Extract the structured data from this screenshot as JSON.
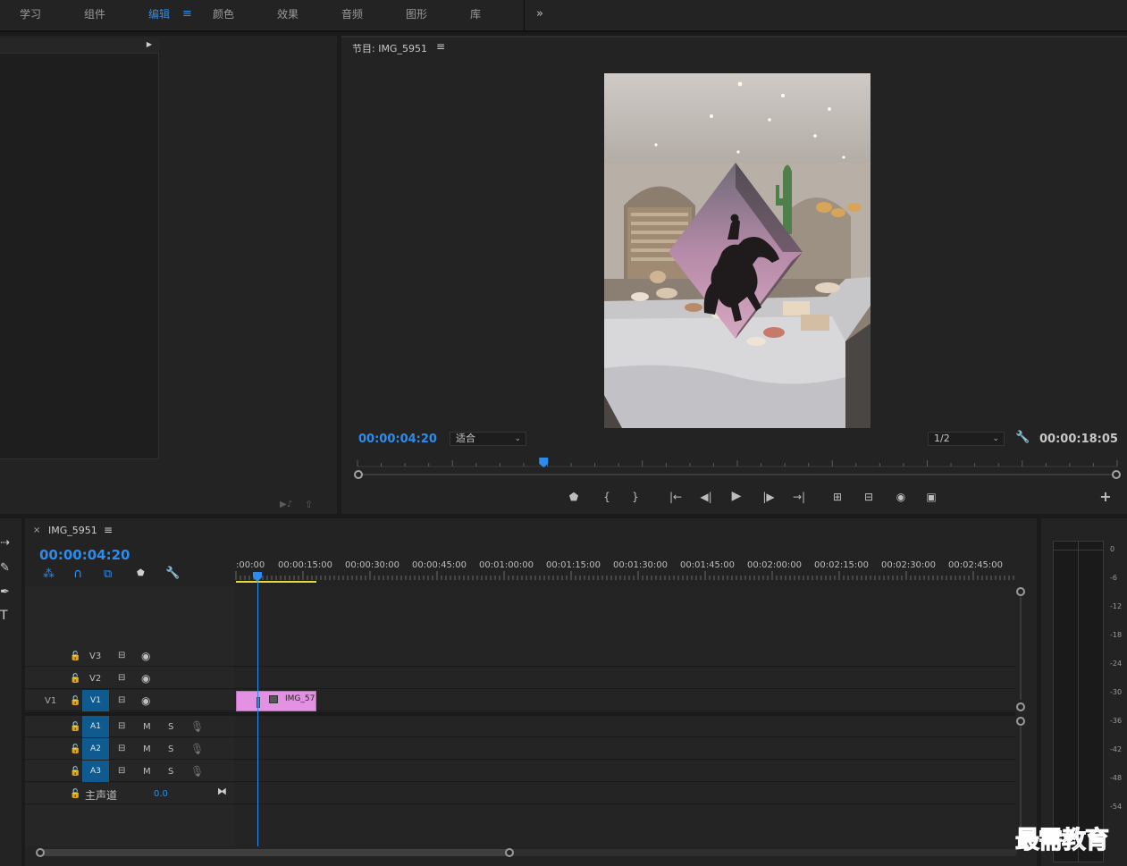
{
  "workspaces": [
    {
      "label": "学习",
      "active": false
    },
    {
      "label": "组件",
      "active": false
    },
    {
      "label": "编辑",
      "active": true
    },
    {
      "label": "颜色",
      "active": false
    },
    {
      "label": "效果",
      "active": false
    },
    {
      "label": "音频",
      "active": false
    },
    {
      "label": "图形",
      "active": false
    },
    {
      "label": "库",
      "active": false
    }
  ],
  "workspace_menu_icon": "hamburger-icon",
  "workspace_more_icon": "double-chevron-right-icon",
  "program": {
    "title": "节目: IMG_5951",
    "menu_icon": "hamburger-icon",
    "current_time": "00:00:04:20",
    "zoom": "适合",
    "resolution": "1/2",
    "duration": "00:00:18:05",
    "playhead_fraction": 0.245
  },
  "timeline": {
    "sequence_name": "IMG_5951",
    "current_time": "00:00:04:20",
    "ruler_labels": [
      ":00:00",
      "00:00:15:00",
      "00:00:30:00",
      "00:00:45:00",
      "00:01:00:00",
      "00:01:15:00",
      "00:01:30:00",
      "00:01:45:00",
      "00:02:00:00",
      "00:02:15:00",
      "00:02:30:00",
      "00:02:45:00"
    ],
    "video_tracks": [
      {
        "name": "V3",
        "source": ""
      },
      {
        "name": "V2",
        "source": ""
      },
      {
        "name": "V1",
        "source": "V1"
      }
    ],
    "audio_tracks": [
      {
        "name": "A1",
        "m": "M",
        "s": "S"
      },
      {
        "name": "A2",
        "m": "M",
        "s": "S"
      },
      {
        "name": "A3",
        "m": "M",
        "s": "S"
      }
    ],
    "master": {
      "label": "主声道",
      "value": "0.0"
    },
    "clip": {
      "label": "IMG_57",
      "color": "#e391e3"
    }
  },
  "meter": {
    "scale": [
      "0",
      "-6",
      "-12",
      "-18",
      "-24",
      "-30",
      "-36",
      "-42",
      "-48",
      "-54"
    ]
  },
  "watermark": "最需教育",
  "colors": {
    "accent": "#2d8ceb",
    "track_selected": "#0f5a8e",
    "clip": "#e391e3",
    "work_area": "#e6d83a"
  }
}
